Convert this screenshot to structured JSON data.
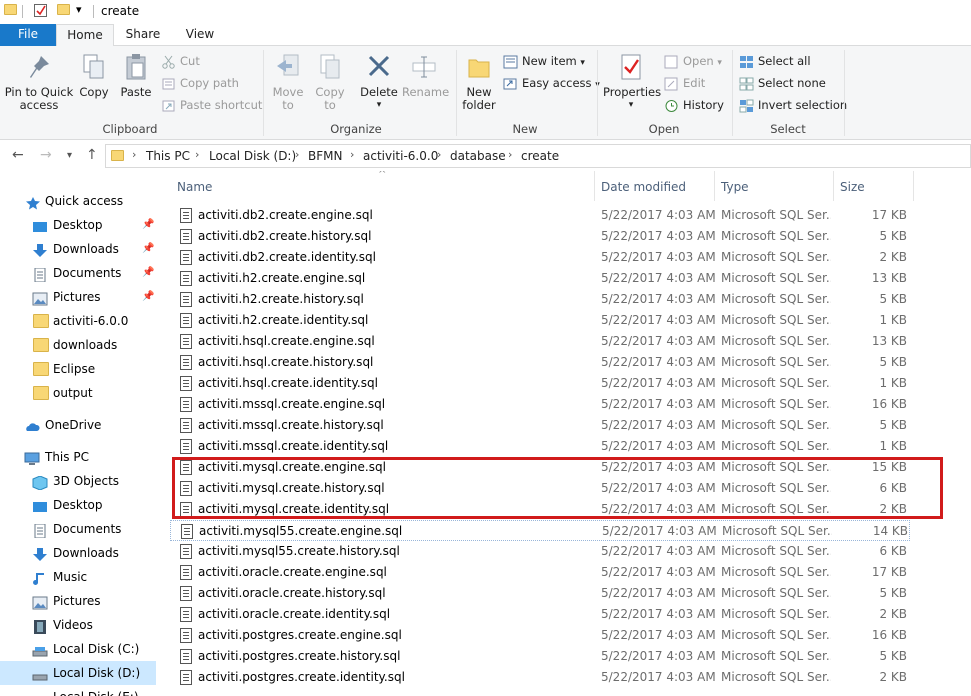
{
  "window": {
    "title": "create"
  },
  "tabs": [
    {
      "label": "File"
    },
    {
      "label": "Home"
    },
    {
      "label": "Share"
    },
    {
      "label": "View"
    }
  ],
  "ribbon": {
    "clipboard": {
      "label": "Clipboard",
      "pin": "Pin to Quick\naccess",
      "copy": "Copy",
      "paste": "Paste",
      "cut": "Cut",
      "copy_path": "Copy path",
      "paste_shortcut": "Paste shortcut"
    },
    "organize": {
      "label": "Organize",
      "move_to": "Move\nto",
      "copy_to": "Copy\nto",
      "delete": "Delete",
      "rename": "Rename"
    },
    "new": {
      "label": "New",
      "new_folder": "New\nfolder",
      "new_item": "New item",
      "easy_access": "Easy access"
    },
    "open": {
      "label": "Open",
      "properties": "Properties",
      "open": "Open",
      "edit": "Edit",
      "history": "History"
    },
    "select": {
      "label": "Select",
      "select_all": "Select all",
      "select_none": "Select none",
      "invert": "Invert selection"
    }
  },
  "address": {
    "crumbs": [
      "This PC",
      "Local Disk (D:)",
      "BFMN",
      "activiti-6.0.0",
      "database",
      "create"
    ]
  },
  "navpane": {
    "quick_access": "Quick access",
    "quick_items": [
      {
        "label": "Desktop",
        "pinned": true
      },
      {
        "label": "Downloads",
        "pinned": true
      },
      {
        "label": "Documents",
        "pinned": true
      },
      {
        "label": "Pictures",
        "pinned": true
      },
      {
        "label": "activiti-6.0.0",
        "pinned": false
      },
      {
        "label": "downloads",
        "pinned": false
      },
      {
        "label": "Eclipse",
        "pinned": false
      },
      {
        "label": "output",
        "pinned": false
      }
    ],
    "onedrive": "OneDrive",
    "this_pc": "This PC",
    "pc_items": [
      {
        "label": "3D Objects"
      },
      {
        "label": "Desktop"
      },
      {
        "label": "Documents"
      },
      {
        "label": "Downloads"
      },
      {
        "label": "Music"
      },
      {
        "label": "Pictures"
      },
      {
        "label": "Videos"
      },
      {
        "label": "Local Disk (C:)"
      },
      {
        "label": "Local Disk (D:)"
      },
      {
        "label": "Local Disk (E:)"
      }
    ]
  },
  "filelist": {
    "columns": {
      "name": "Name",
      "date": "Date modified",
      "type": "Type",
      "size": "Size"
    },
    "rows": [
      {
        "name": "activiti.db2.create.engine.sql",
        "date": "5/22/2017 4:03 AM",
        "type": "Microsoft SQL Ser...",
        "size": "17 KB"
      },
      {
        "name": "activiti.db2.create.history.sql",
        "date": "5/22/2017 4:03 AM",
        "type": "Microsoft SQL Ser...",
        "size": "5 KB"
      },
      {
        "name": "activiti.db2.create.identity.sql",
        "date": "5/22/2017 4:03 AM",
        "type": "Microsoft SQL Ser...",
        "size": "2 KB"
      },
      {
        "name": "activiti.h2.create.engine.sql",
        "date": "5/22/2017 4:03 AM",
        "type": "Microsoft SQL Ser...",
        "size": "13 KB"
      },
      {
        "name": "activiti.h2.create.history.sql",
        "date": "5/22/2017 4:03 AM",
        "type": "Microsoft SQL Ser...",
        "size": "5 KB"
      },
      {
        "name": "activiti.h2.create.identity.sql",
        "date": "5/22/2017 4:03 AM",
        "type": "Microsoft SQL Ser...",
        "size": "1 KB"
      },
      {
        "name": "activiti.hsql.create.engine.sql",
        "date": "5/22/2017 4:03 AM",
        "type": "Microsoft SQL Ser...",
        "size": "13 KB"
      },
      {
        "name": "activiti.hsql.create.history.sql",
        "date": "5/22/2017 4:03 AM",
        "type": "Microsoft SQL Ser...",
        "size": "5 KB"
      },
      {
        "name": "activiti.hsql.create.identity.sql",
        "date": "5/22/2017 4:03 AM",
        "type": "Microsoft SQL Ser...",
        "size": "1 KB"
      },
      {
        "name": "activiti.mssql.create.engine.sql",
        "date": "5/22/2017 4:03 AM",
        "type": "Microsoft SQL Ser...",
        "size": "16 KB"
      },
      {
        "name": "activiti.mssql.create.history.sql",
        "date": "5/22/2017 4:03 AM",
        "type": "Microsoft SQL Ser...",
        "size": "5 KB"
      },
      {
        "name": "activiti.mssql.create.identity.sql",
        "date": "5/22/2017 4:03 AM",
        "type": "Microsoft SQL Ser...",
        "size": "1 KB"
      },
      {
        "name": "activiti.mysql.create.engine.sql",
        "date": "5/22/2017 4:03 AM",
        "type": "Microsoft SQL Ser...",
        "size": "15 KB"
      },
      {
        "name": "activiti.mysql.create.history.sql",
        "date": "5/22/2017 4:03 AM",
        "type": "Microsoft SQL Ser...",
        "size": "6 KB"
      },
      {
        "name": "activiti.mysql.create.identity.sql",
        "date": "5/22/2017 4:03 AM",
        "type": "Microsoft SQL Ser...",
        "size": "2 KB"
      },
      {
        "name": "activiti.mysql55.create.engine.sql",
        "date": "5/22/2017 4:03 AM",
        "type": "Microsoft SQL Ser...",
        "size": "14 KB"
      },
      {
        "name": "activiti.mysql55.create.history.sql",
        "date": "5/22/2017 4:03 AM",
        "type": "Microsoft SQL Ser...",
        "size": "6 KB"
      },
      {
        "name": "activiti.oracle.create.engine.sql",
        "date": "5/22/2017 4:03 AM",
        "type": "Microsoft SQL Ser...",
        "size": "17 KB"
      },
      {
        "name": "activiti.oracle.create.history.sql",
        "date": "5/22/2017 4:03 AM",
        "type": "Microsoft SQL Ser...",
        "size": "5 KB"
      },
      {
        "name": "activiti.oracle.create.identity.sql",
        "date": "5/22/2017 4:03 AM",
        "type": "Microsoft SQL Ser...",
        "size": "2 KB"
      },
      {
        "name": "activiti.postgres.create.engine.sql",
        "date": "5/22/2017 4:03 AM",
        "type": "Microsoft SQL Ser...",
        "size": "16 KB"
      },
      {
        "name": "activiti.postgres.create.history.sql",
        "date": "5/22/2017 4:03 AM",
        "type": "Microsoft SQL Ser...",
        "size": "5 KB"
      },
      {
        "name": "activiti.postgres.create.identity.sql",
        "date": "5/22/2017 4:03 AM",
        "type": "Microsoft SQL Ser...",
        "size": "2 KB"
      }
    ]
  },
  "colors": {
    "accent": "#1979ca",
    "highlight": "#d11b1b",
    "selected": "#cce8ff"
  }
}
